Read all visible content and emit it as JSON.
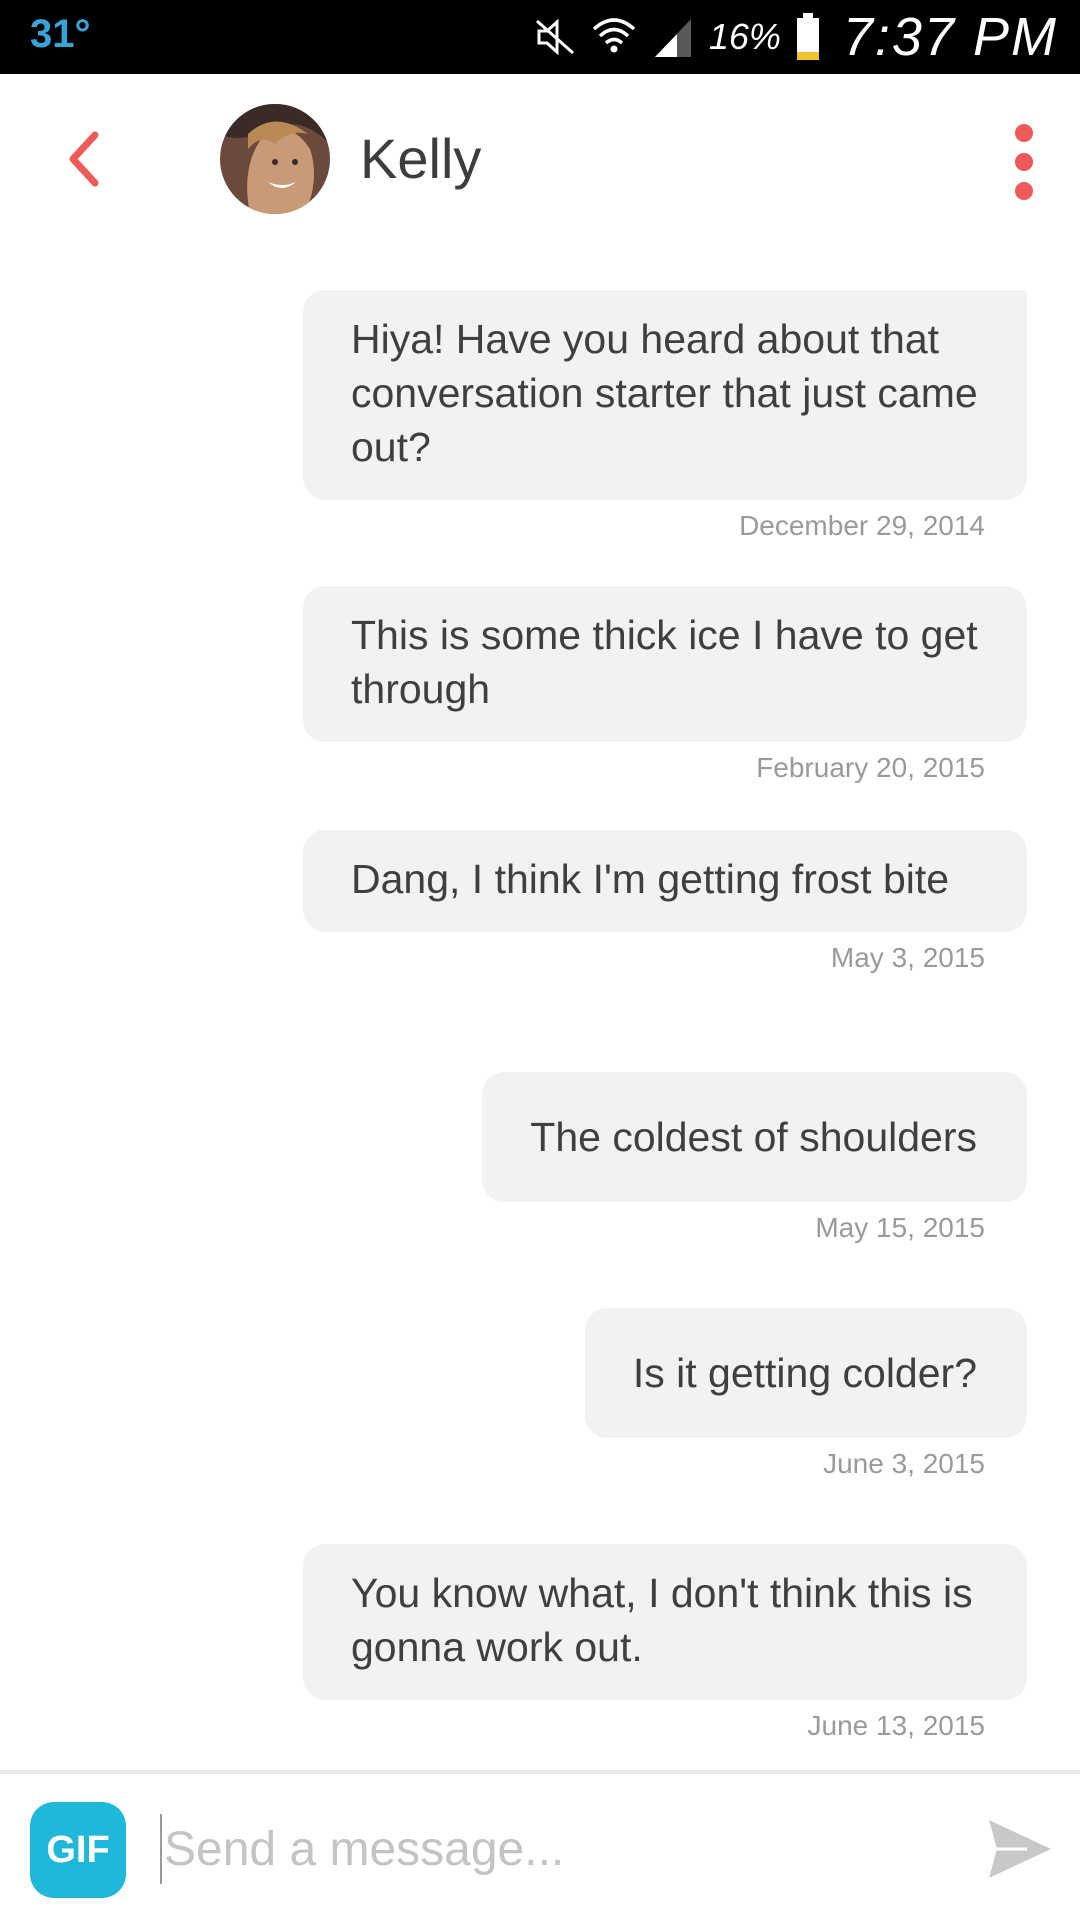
{
  "status_bar": {
    "temperature": "31°",
    "battery_percent": "16%",
    "time": "7:37 PM",
    "icons": [
      "mute-icon",
      "wifi-icon",
      "signal-icon",
      "battery-icon"
    ]
  },
  "header": {
    "contact_name": "Kelly",
    "back_icon": "chevron-left-icon",
    "menu_icon": "more-vertical-icon",
    "accent_color": "#ee5a5a"
  },
  "messages": [
    {
      "text": "Hiya! Have you heard about that conversation starter that just came out?",
      "date": "December 29, 2014"
    },
    {
      "text": "This is some thick ice I have to get through",
      "date": "February 20, 2015"
    },
    {
      "text": "Dang, I think I'm getting frost bite",
      "date": "May 3, 2015"
    },
    {
      "text": "The coldest of shoulders",
      "date": "May 15, 2015"
    },
    {
      "text": "Is it getting colder?",
      "date": "June 3, 2015"
    },
    {
      "text": "You know what, I don't think this is gonna work out.",
      "date": "June 13, 2015"
    }
  ],
  "composer": {
    "gif_label": "GIF",
    "placeholder": "Send a message...",
    "value": "",
    "send_icon": "send-icon",
    "gif_color": "#1fb8d8"
  },
  "colors": {
    "bubble": "#f2f2f2",
    "timestamp": "#9a9a9a",
    "text": "#3f3f3f"
  }
}
